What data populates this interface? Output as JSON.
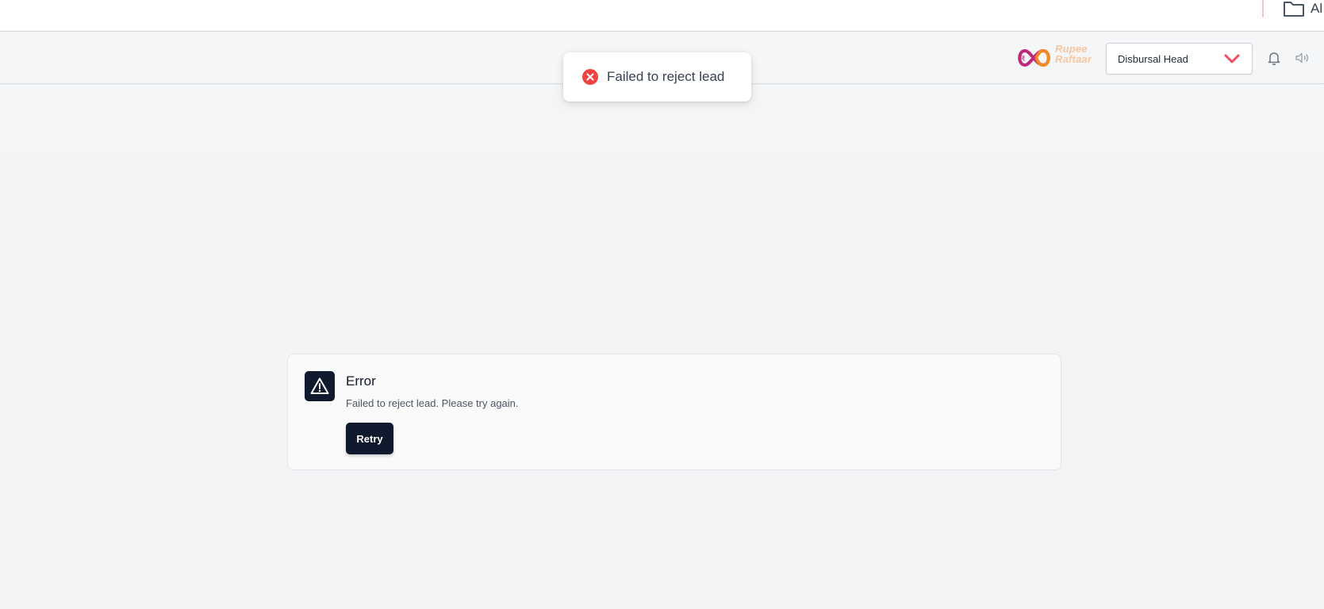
{
  "top_strip": {
    "folder_label": "Al"
  },
  "header": {
    "logo": {
      "text_line1": "Rupee",
      "text_line2": "Raftaar",
      "icon": "infinity-logo-icon"
    },
    "role_select": {
      "value": "Disbursal Head",
      "icon": "chevron-down-icon"
    },
    "icons": [
      "bell-icon",
      "speaker-icon"
    ]
  },
  "toast": {
    "icon": "error-x-icon",
    "message": "Failed to reject lead"
  },
  "error_card": {
    "icon": "warning-triangle-icon",
    "title": "Error",
    "description": "Failed to reject lead. Please try again.",
    "retry_label": "Retry"
  },
  "colors": {
    "accent_dark": "#0f1a2e",
    "error_red": "#ef4444",
    "chevron_red": "#ef4d63",
    "logo_pink": "#c0267a",
    "logo_orange": "#f08a24"
  }
}
